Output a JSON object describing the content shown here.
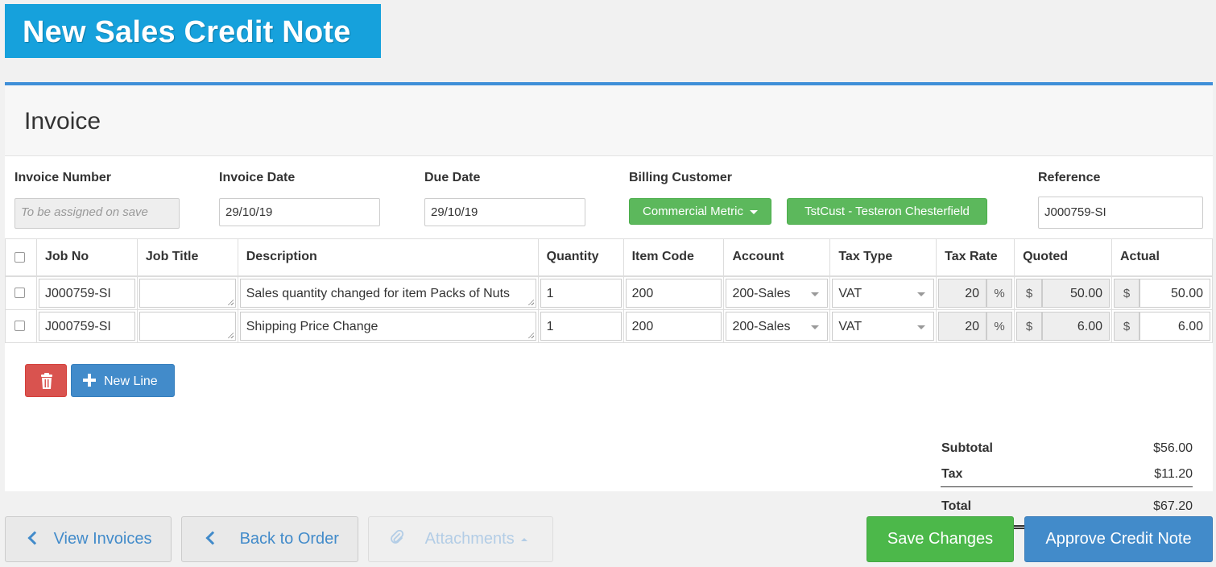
{
  "page_title": "New Sales Credit Note",
  "panel": {
    "title": "Invoice"
  },
  "fields": {
    "invoice_number": {
      "label": "Invoice Number",
      "placeholder": "To be assigned on save"
    },
    "invoice_date": {
      "label": "Invoice Date",
      "value": "29/10/19"
    },
    "due_date": {
      "label": "Due Date",
      "value": "29/10/19"
    },
    "billing_customer": {
      "label": "Billing Customer",
      "dropdown": "Commercial Metric",
      "customer": "TstCust - Testeron Chesterfield"
    },
    "reference": {
      "label": "Reference",
      "value": "J000759-SI"
    }
  },
  "table": {
    "headers": [
      "Job No",
      "Job Title",
      "Description",
      "Quantity",
      "Item Code",
      "Account",
      "Tax Type",
      "Tax Rate",
      "Quoted",
      "Actual"
    ],
    "rows": [
      {
        "job_no": "J000759-SI",
        "job_title": "",
        "description": "Sales quantity changed for item Packs of Nuts",
        "quantity": "1",
        "item_code": "200",
        "account": "200-Sales",
        "tax_type": "VAT",
        "tax_rate": "20",
        "quoted": "50.00",
        "actual": "50.00"
      },
      {
        "job_no": "J000759-SI",
        "job_title": "",
        "description": "Shipping Price Change",
        "quantity": "1",
        "item_code": "200",
        "account": "200-Sales",
        "tax_type": "VAT",
        "tax_rate": "20",
        "quoted": "6.00",
        "actual": "6.00"
      }
    ],
    "percent_symbol": "%",
    "currency_symbol": "$"
  },
  "actions": {
    "new_line": "New Line"
  },
  "totals": {
    "subtotal_label": "Subtotal",
    "subtotal": "$56.00",
    "tax_label": "Tax",
    "tax": "$11.20",
    "total_label": "Total",
    "total": "$67.20"
  },
  "footer": {
    "view_invoices": "View Invoices",
    "back_to_order": "Back to Order",
    "attachments": "Attachments",
    "save_changes": "Save Changes",
    "approve": "Approve Credit Note"
  },
  "colors": {
    "title_bg": "#16a1dc",
    "accent": "#3f8fd8",
    "success": "#5cb85c",
    "danger": "#d9534f",
    "primary": "#428bca"
  }
}
